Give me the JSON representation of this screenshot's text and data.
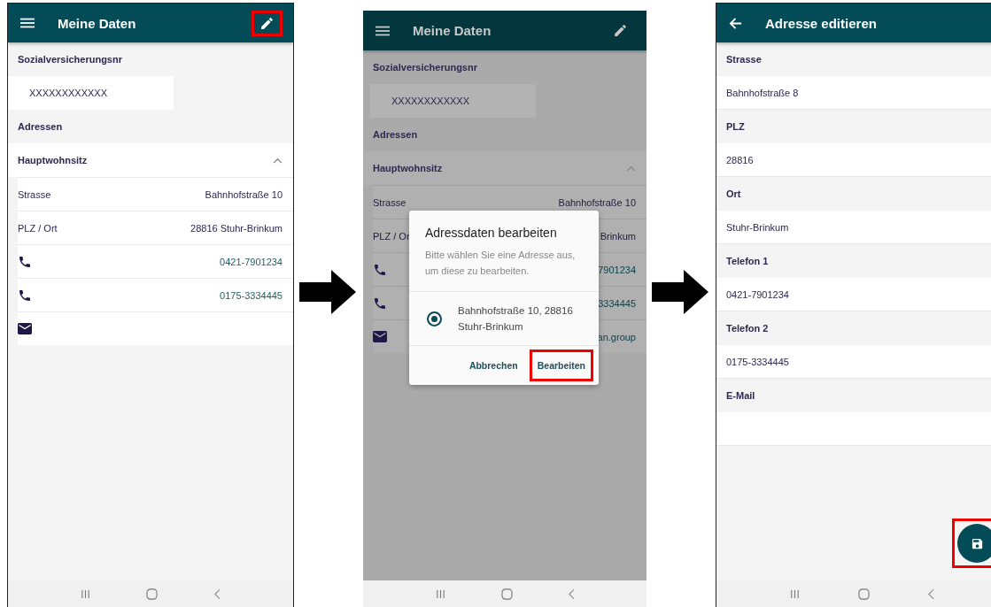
{
  "screens": [
    {
      "kind": "overview",
      "title": "Meine Daten",
      "action": {
        "highlighted": true
      },
      "dimmed": false,
      "items": [
        {
          "kind": "header",
          "text": "Sozialversicherungsnr"
        },
        {
          "kind": "value",
          "text": "XXXXXXXXXXXX"
        },
        {
          "kind": "header",
          "text": "Adressen"
        },
        {
          "kind": "group",
          "text": "Hauptwohnsitz",
          "expanded": true
        },
        {
          "kind": "detail",
          "label": "Strasse",
          "value": "Bahnhofstraße 10"
        },
        {
          "kind": "detail",
          "label": "PLZ / Ort",
          "value": "28816 Stuhr-Brinkum"
        },
        {
          "kind": "phone",
          "value": "0421-7901234"
        },
        {
          "kind": "phone",
          "value": "0175-3334445"
        },
        {
          "kind": "mail"
        }
      ]
    },
    {
      "kind": "overview",
      "title": "Meine Daten",
      "action": {
        "highlighted": false
      },
      "dimmed": true,
      "items": [
        {
          "kind": "header",
          "text": "Sozialversicherungsnr"
        },
        {
          "kind": "value",
          "text": "XXXXXXXXXXXX"
        },
        {
          "kind": "header",
          "text": "Adressen"
        },
        {
          "kind": "group",
          "text": "Hauptwohnsitz",
          "expanded": true
        },
        {
          "kind": "detail",
          "label": "Strasse",
          "value": "Bahnhofstraße 10"
        },
        {
          "kind": "detail",
          "label": "PLZ / Or",
          "value": "Brinkum"
        },
        {
          "kind": "phone",
          "value": "7901234"
        },
        {
          "kind": "phone",
          "value": "3334445"
        },
        {
          "kind": "mail",
          "value": "an.group"
        }
      ],
      "dialog": {
        "title": "Adressdaten bearbeiten",
        "message": "Bitte wählen Sie eine Adresse aus, um diese zu bearbeiten.",
        "options": [
          {
            "label": "Bahnhofstraße 10, 28816 Stuhr-Brinkum",
            "selected": true
          }
        ],
        "buttons": [
          {
            "label": "Abbrechen",
            "highlighted": false
          },
          {
            "label": "Bearbeiten",
            "highlighted": true
          }
        ]
      }
    },
    {
      "kind": "edit",
      "title": "Adresse editieren",
      "dimmed": false,
      "items": [
        {
          "kind": "field",
          "label": "Strasse",
          "value": "Bahnhofstraße 8"
        },
        {
          "kind": "field",
          "label": "PLZ",
          "value": "28816"
        },
        {
          "kind": "field",
          "label": "Ort",
          "value": "Stuhr-Brinkum"
        },
        {
          "kind": "field",
          "label": "Telefon 1",
          "value": "0421-7901234"
        },
        {
          "kind": "field",
          "label": "Telefon 2",
          "value": "0175-3334445"
        },
        {
          "kind": "field",
          "label": "E-Mail"
        }
      ],
      "fab": {
        "highlighted": true
      }
    }
  ]
}
